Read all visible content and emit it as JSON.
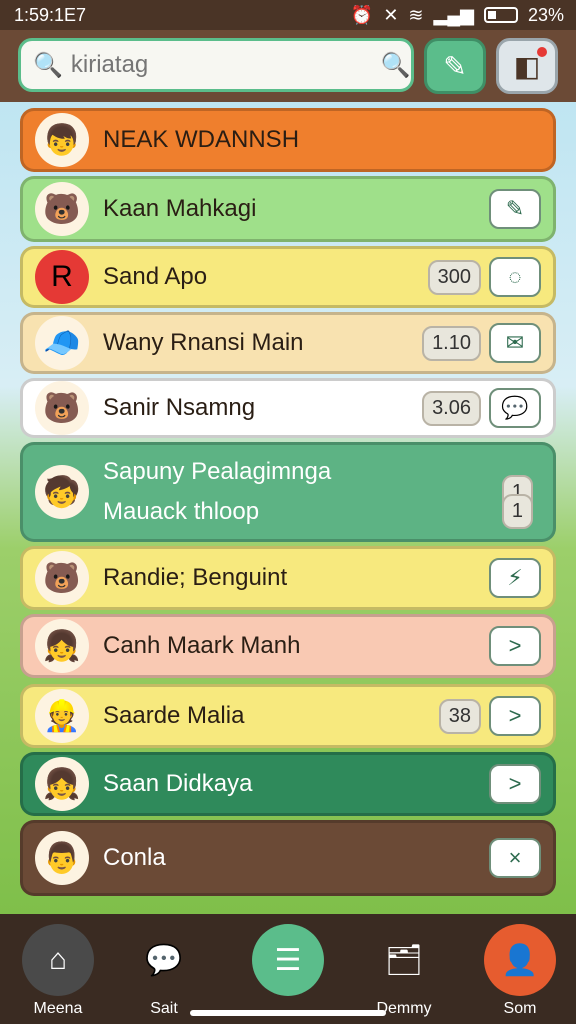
{
  "status": {
    "time": "1:59:1E7",
    "battery": "23%"
  },
  "search": {
    "placeholder": "kiriatag"
  },
  "items": [
    {
      "label": "NEAK WDANNSH",
      "count": "",
      "action": "",
      "avatar": "👦",
      "bg": "#ef7f2d",
      "color": "#2a1e14"
    },
    {
      "label": "Kaan Mahkagi",
      "count": "",
      "action": "✎",
      "avatar": "🐻",
      "bg": "#9fe08a",
      "color": "#2a1e14"
    },
    {
      "label": "Sand Apo",
      "count": "300",
      "action": "◌",
      "avatar": "R",
      "bg": "#f7e97e",
      "color": "#2a1e14"
    },
    {
      "label": "Wany Rnansi Main",
      "count": "1.10",
      "action": "✉",
      "avatar": "🧢",
      "bg": "#f8e2b0",
      "color": "#2a1e14"
    },
    {
      "label": "Sanir Nsamng",
      "count": "3.06",
      "action": "💬",
      "avatar": "🐻",
      "bg": "#ffffff",
      "color": "#2a1e14"
    },
    {
      "label": "Sapuny Pealagimnga",
      "count": "1",
      "action": "",
      "avatar": "🧒",
      "bg": "#5db384",
      "color": "#fff",
      "sub": "Mauack thloop",
      "count2": "1"
    },
    {
      "label": "Randie; Benguint",
      "count": "",
      "action": "⚡",
      "avatar": "🐻",
      "bg": "#f7e97e",
      "color": "#2a1e14"
    },
    {
      "label": "Canh Maark Manh",
      "count": "",
      "action": ">",
      "avatar": "👧",
      "bg": "#f9c9b3",
      "color": "#2a1e14"
    },
    {
      "label": "Saarde Malia",
      "count": "38",
      "action": ">",
      "avatar": "👷",
      "bg": "#f7e97e",
      "color": "#2a1e14"
    },
    {
      "label": "Saan Didkaya",
      "count": "",
      "action": ">",
      "avatar": "👧",
      "bg": "#2f8a5b",
      "color": "#fff"
    },
    {
      "label": "Conla",
      "count": "",
      "action": "×",
      "avatar": "👨",
      "bg": "#6b4a36",
      "color": "#fff"
    }
  ],
  "nav": [
    {
      "label": "Meena",
      "icon": "⌂",
      "bg": "#4a4a4a"
    },
    {
      "label": "Sait",
      "icon": "💬",
      "bg": "transparent"
    },
    {
      "label": "",
      "icon": "☰",
      "bg": "#5bbd8b"
    },
    {
      "label": "Demmy",
      "icon": "🗂",
      "bg": "transparent"
    },
    {
      "label": "Som",
      "icon": "👤",
      "bg": "#e65c2f"
    }
  ]
}
